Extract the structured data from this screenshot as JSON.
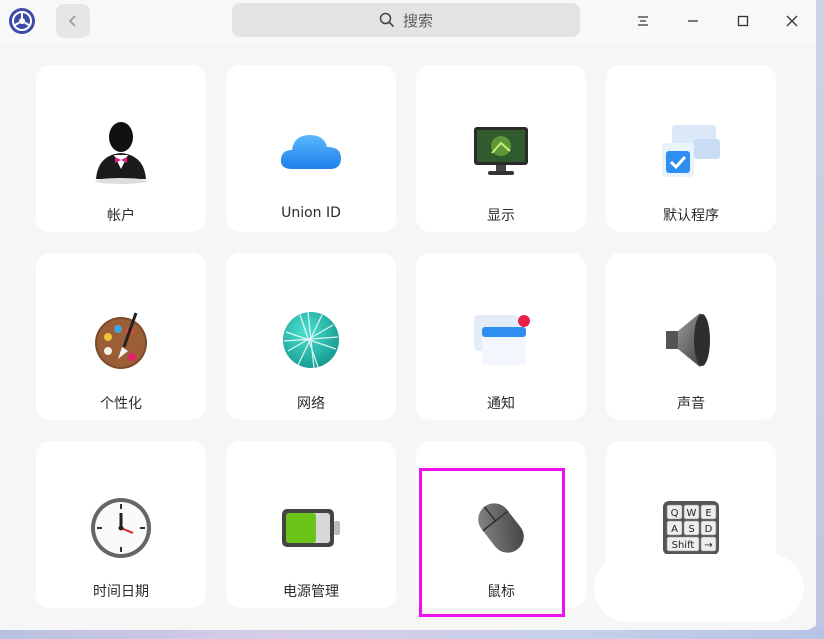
{
  "window": {
    "search_placeholder": "搜索"
  },
  "titlebar": {
    "back_icon": "chevron-left-icon",
    "menu_icon": "menu-icon",
    "minimize_icon": "minimize-icon",
    "maximize_icon": "maximize-icon",
    "close_icon": "close-icon"
  },
  "modules": [
    {
      "label": "帐户",
      "icon": "account-icon"
    },
    {
      "label": "Union ID",
      "icon": "cloud-icon"
    },
    {
      "label": "显示",
      "icon": "display-icon"
    },
    {
      "label": "默认程序",
      "icon": "default-apps-icon"
    },
    {
      "label": "个性化",
      "icon": "palette-icon"
    },
    {
      "label": "网络",
      "icon": "network-globe-icon"
    },
    {
      "label": "通知",
      "icon": "notification-icon"
    },
    {
      "label": "声音",
      "icon": "speaker-icon"
    },
    {
      "label": "时间日期",
      "icon": "clock-icon"
    },
    {
      "label": "电源管理",
      "icon": "battery-icon"
    },
    {
      "label": "鼠标",
      "icon": "mouse-icon"
    },
    {
      "label": "",
      "icon": "keyboard-icon"
    }
  ],
  "keyboard_keys": [
    "Q",
    "W",
    "E",
    "A",
    "S",
    "D",
    "Shift",
    "→"
  ],
  "colors": {
    "highlight": "#ee10ee",
    "accent": "#1e90ff"
  }
}
